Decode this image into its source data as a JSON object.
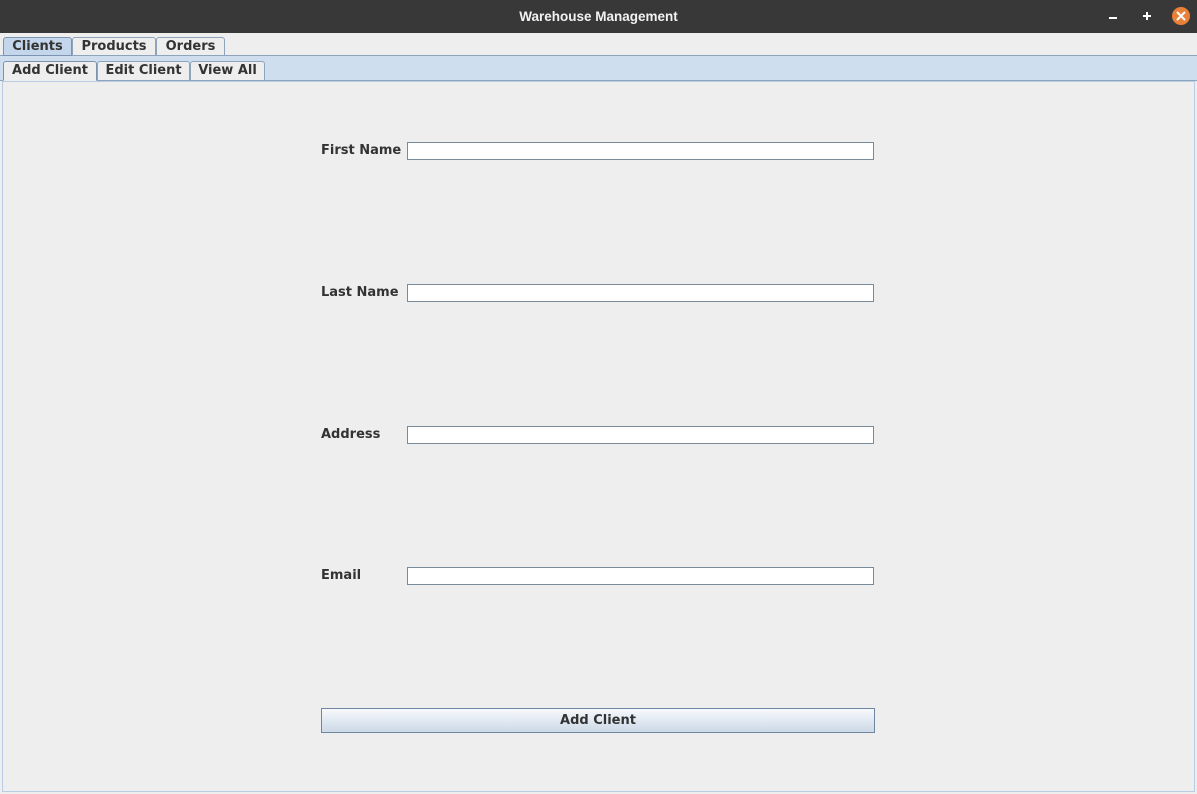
{
  "window": {
    "title": "Warehouse Management"
  },
  "top_tabs": [
    {
      "label": "Clients",
      "selected": true
    },
    {
      "label": "Products",
      "selected": false
    },
    {
      "label": "Orders",
      "selected": false
    }
  ],
  "sub_tabs": [
    {
      "label": "Add Client",
      "selected": true
    },
    {
      "label": "Edit Client",
      "selected": false
    },
    {
      "label": "View All",
      "selected": false
    }
  ],
  "form": {
    "fields": [
      {
        "label": "First Name",
        "value": ""
      },
      {
        "label": "Last Name",
        "value": ""
      },
      {
        "label": "Address",
        "value": ""
      },
      {
        "label": "Email",
        "value": ""
      }
    ],
    "submit_label": "Add Client"
  },
  "colors": {
    "titlebar": "#383838",
    "close_button": "#e9803a",
    "tab_selected": "#c3d6ec",
    "subtab_bar": "#cfdeef",
    "background": "#eeeeee"
  },
  "icons": {
    "minimize": "minimize-icon",
    "maximize": "maximize-icon",
    "close": "close-icon"
  }
}
